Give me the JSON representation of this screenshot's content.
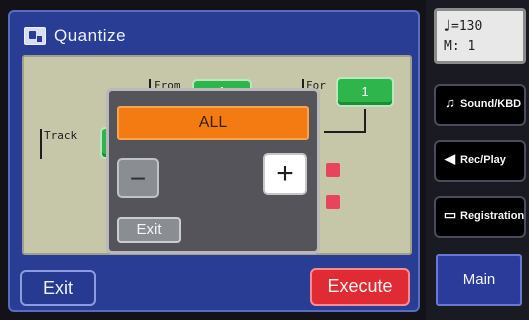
{
  "window": {
    "title": "Quantize"
  },
  "panel": {
    "labels": {
      "from": "From",
      "for": "For",
      "track": "Track"
    },
    "buttons": {
      "from_value": "1",
      "for_value": "1",
      "track_value": ""
    }
  },
  "modal": {
    "value": "ALL",
    "minus_symbol": "−",
    "plus_symbol": "+",
    "exit_label": "Exit"
  },
  "bottom": {
    "exit_label": "Exit",
    "execute_label": "Execute"
  },
  "sidebar": {
    "tempo_note_icon": "♩",
    "tempo_value": "=130",
    "measure_value": "M:    1",
    "buttons": [
      {
        "label": "Sound/KBD",
        "icon": "music-note-icon"
      },
      {
        "label": "Rec/Play",
        "icon": "speaker-icon"
      },
      {
        "label": "Registration",
        "icon": "registration-icon"
      }
    ],
    "main_label": "Main"
  }
}
